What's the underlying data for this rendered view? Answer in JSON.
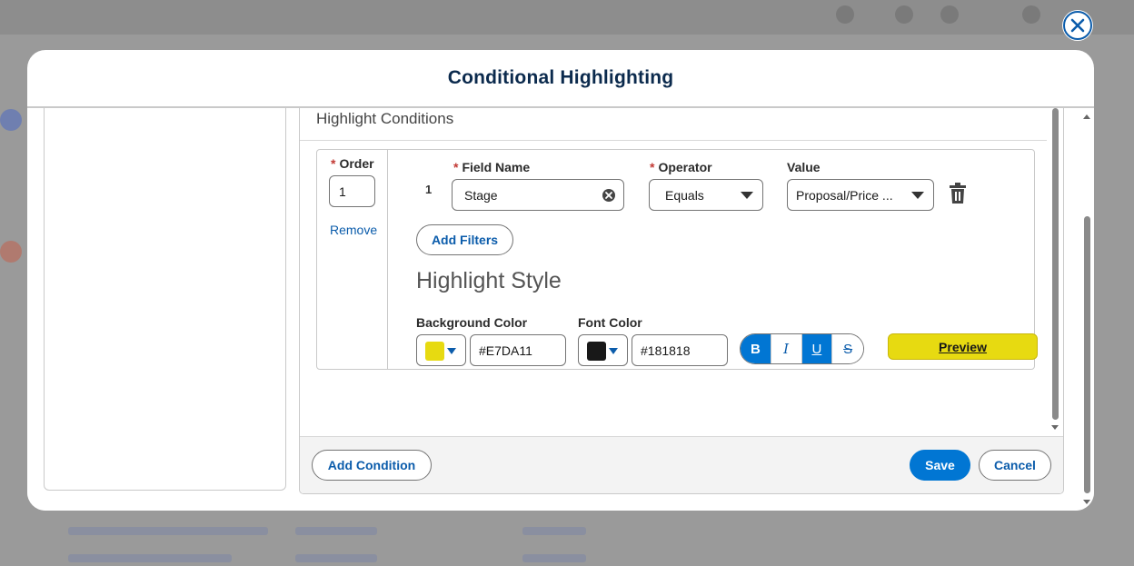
{
  "modal": {
    "title": "Conditional Highlighting",
    "close_icon": "close-icon"
  },
  "conditions": {
    "title": "Highlight Conditions",
    "order_label": "Order",
    "order_value": "1",
    "remove_label": "Remove",
    "row_number": "1",
    "field_name_label": "Field Name",
    "field_name_value": "Stage",
    "operator_label": "Operator",
    "operator_value": "Equals",
    "value_label": "Value",
    "value_value": "Proposal/Price ...",
    "add_filters_label": "Add Filters",
    "delete_icon": "trash-icon"
  },
  "highlight_style": {
    "title": "Highlight Style",
    "bg_color_label": "Background Color",
    "bg_color_value": "#E7DA11",
    "font_color_label": "Font Color",
    "font_color_value": "#181818",
    "format_buttons": {
      "bold": {
        "label": "B",
        "active": true
      },
      "italic": {
        "label": "I",
        "active": false
      },
      "underline": {
        "label": "U",
        "active": true
      },
      "strikethrough": {
        "label": "S",
        "active": false
      }
    },
    "preview_label": "Preview"
  },
  "footer": {
    "add_condition_label": "Add Condition",
    "save_label": "Save",
    "cancel_label": "Cancel"
  },
  "colors": {
    "brand": "#0176d3",
    "link": "#0b5cab",
    "required": "#c23934",
    "title": "#0b2a4d"
  }
}
